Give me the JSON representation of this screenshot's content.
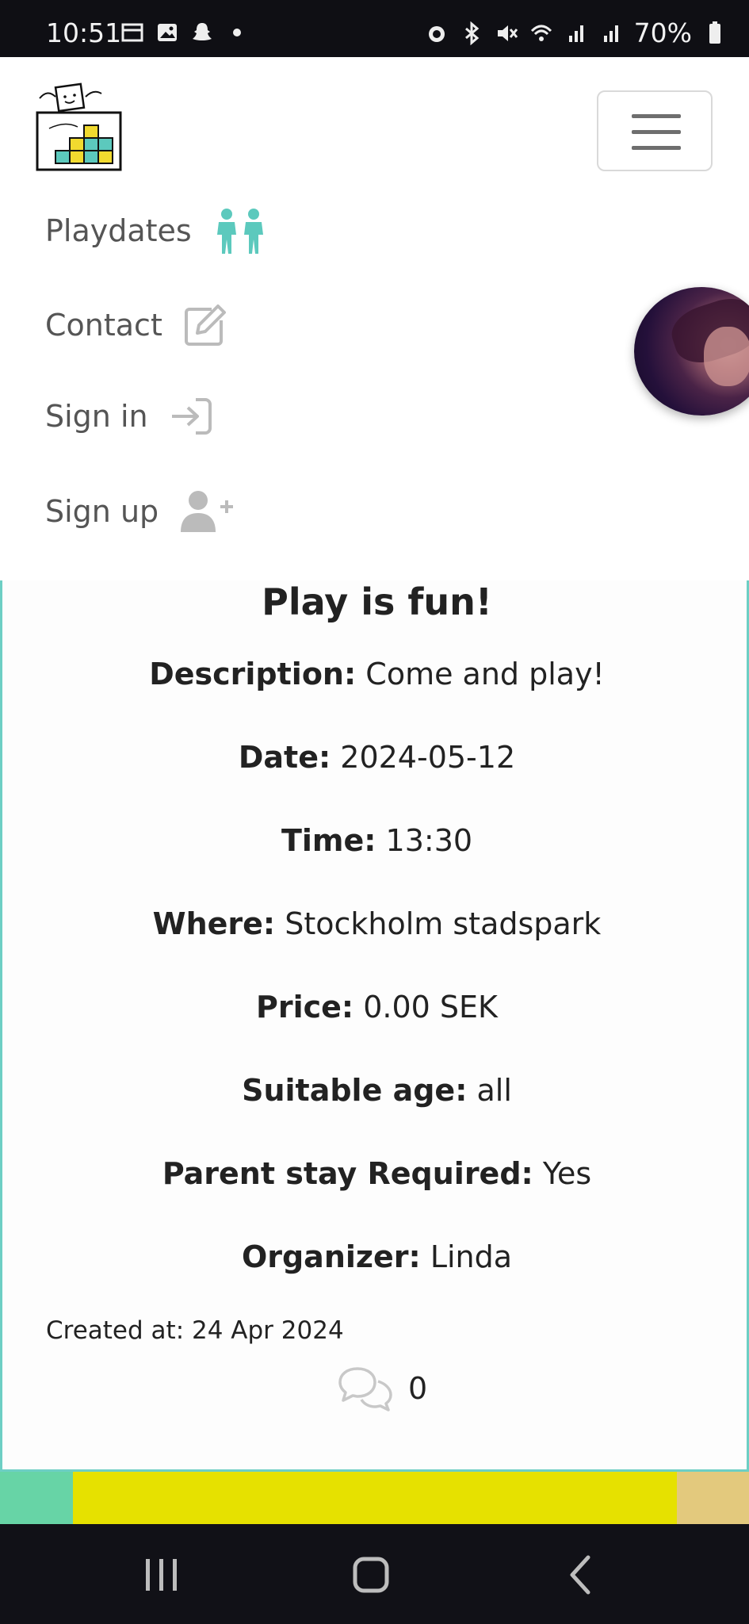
{
  "status_bar": {
    "time": "10:51",
    "battery": "70%",
    "left_icons": [
      "calendar-icon",
      "gallery-icon",
      "snapchat-icon",
      "dot-icon"
    ],
    "right_icons": [
      "alarm-icon",
      "bluetooth-icon",
      "mute-icon",
      "wifi-icon",
      "signal-icon",
      "signal-icon",
      "battery-icon"
    ]
  },
  "nav": {
    "items": [
      {
        "label": "Playdates",
        "icon": "children-icon",
        "icon_color": "#5cc9bd"
      },
      {
        "label": "Contact",
        "icon": "edit-icon"
      },
      {
        "label": "Sign in",
        "icon": "sign-in-icon"
      },
      {
        "label": "Sign up",
        "icon": "user-plus-icon"
      }
    ]
  },
  "playdate": {
    "title": "Play is fun!",
    "fields": [
      {
        "label": "Description:",
        "value": "Come and play!"
      },
      {
        "label": "Date:",
        "value": "2024-05-12"
      },
      {
        "label": "Time:",
        "value": "13:30"
      },
      {
        "label": "Where:",
        "value": "Stockholm stadspark"
      },
      {
        "label": "Price:",
        "value": "0.00 SEK"
      },
      {
        "label": "Suitable age:",
        "value": "all"
      },
      {
        "label": "Parent stay Required:",
        "value": "Yes"
      },
      {
        "label": "Organizer:",
        "value": "Linda"
      }
    ],
    "created_at": "Created at: 24 Apr 2024",
    "comment_count": "0"
  },
  "colors": {
    "accent": "#6dcfc4",
    "footer_green": "#67d4a6",
    "footer_yellow": "#e6e100",
    "footer_tan": "#e3c97d"
  }
}
